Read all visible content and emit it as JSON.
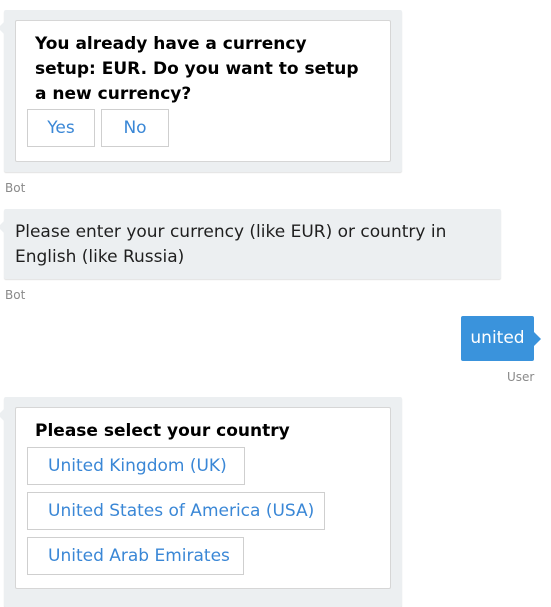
{
  "messages": [
    {
      "from": "Bot",
      "card_title": "You already have a currency setup: EUR. Do you want to setup a new currency?",
      "buttons": [
        "Yes",
        "No"
      ],
      "sender_label": "Bot"
    },
    {
      "from": "Bot",
      "text": "Please enter your currency (like EUR) or country in English (like Russia)",
      "sender_label": "Bot"
    },
    {
      "from": "User",
      "text": "united",
      "sender_label": "User"
    },
    {
      "from": "Bot",
      "card_title": "Please select your country",
      "buttons": [
        "United Kingdom (UK)",
        "United States of America (USA)",
        "United Arab Emirates"
      ]
    }
  ],
  "colors": {
    "accent": "#3a87d6",
    "user_bubble": "#3a93dc",
    "bot_bubble": "#eceff1"
  }
}
